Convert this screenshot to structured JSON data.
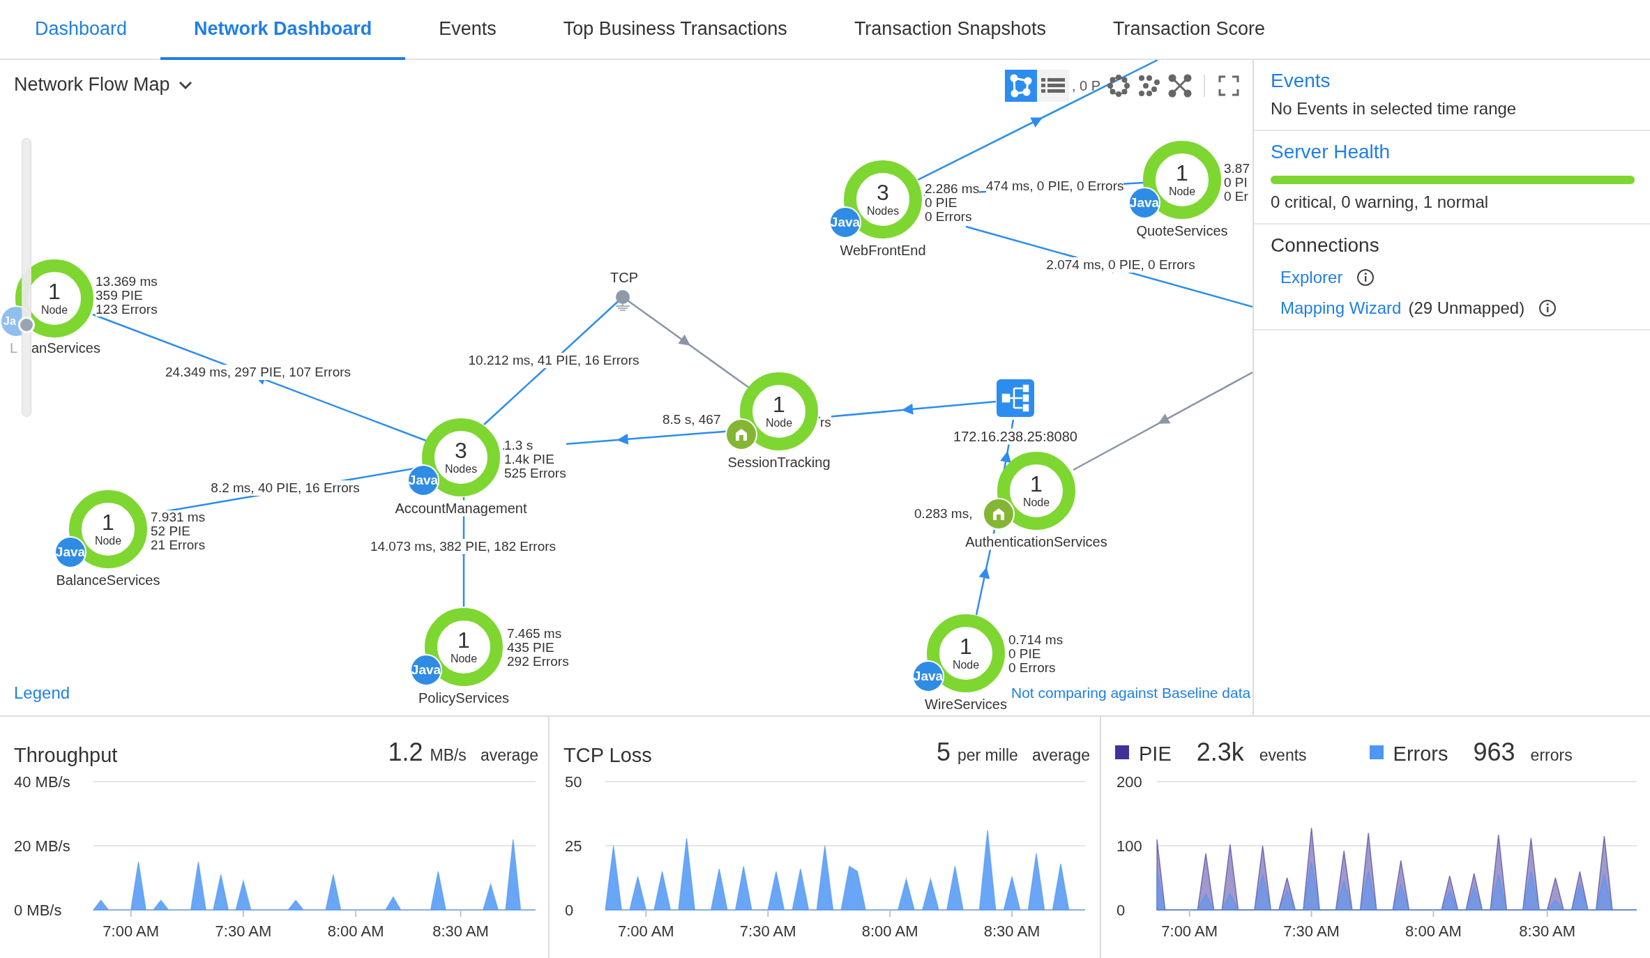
{
  "tabs": [
    {
      "label": "Dashboard",
      "selected": false,
      "kind": "link"
    },
    {
      "label": "Network Dashboard",
      "selected": true,
      "kind": "tab"
    },
    {
      "label": "Events",
      "selected": false,
      "kind": "tab"
    },
    {
      "label": "Top Business Transactions",
      "selected": false,
      "kind": "tab"
    },
    {
      "label": "Transaction Snapshots",
      "selected": false,
      "kind": "tab"
    },
    {
      "label": "Transaction Score",
      "selected": false,
      "kind": "tab"
    }
  ],
  "map": {
    "title": "Network Flow Map",
    "toolbar": [
      {
        "kind": "flow",
        "selected": true
      },
      {
        "kind": "list",
        "selected": false
      },
      {
        "kind": "circle",
        "selected": false
      },
      {
        "kind": "cluster",
        "selected": false
      },
      {
        "kind": "cross",
        "selected": false
      },
      {
        "kind": "fullscreen",
        "selected": false
      }
    ],
    "toolbar_backdrop_text": ", 0 P",
    "zoom_slider": {
      "level": 0.33
    },
    "nodes": [
      {
        "name": "anServices",
        "cut_letter": "L",
        "count": "1",
        "unit": "Node",
        "badge": {
          "kind": "java",
          "label": "Ja"
        },
        "stats": [
          "13.369 ms",
          "359 PIE",
          "123 Errors"
        ]
      },
      {
        "name": "AccountManagement",
        "count": "3",
        "unit": "Nodes",
        "badge": {
          "kind": "java",
          "label": "Java"
        },
        "stats": [
          "1.3 s",
          "1.4k PIE",
          "525 Errors"
        ]
      },
      {
        "name": "BalanceServices",
        "count": "1",
        "unit": "Node",
        "badge": {
          "kind": "java",
          "label": "Java"
        },
        "stats": [
          "7.931 ms",
          "52 PIE",
          "21 Errors"
        ]
      },
      {
        "name": "PolicyServices",
        "count": "1",
        "unit": "Node",
        "badge": {
          "kind": "java",
          "label": "Java"
        },
        "stats": [
          "7.465 ms",
          "435 PIE",
          "292 Errors"
        ]
      },
      {
        "name": "SessionTracking",
        "count": "1",
        "unit": "Node",
        "badge": {
          "kind": "home"
        }
      },
      {
        "name": "WebFrontEnd",
        "count": "3",
        "unit": "Nodes",
        "badge": {
          "kind": "java",
          "label": "Java"
        },
        "stats": [
          "2.286 ms",
          "0 PIE",
          "0 Errors"
        ]
      },
      {
        "name": "QuoteServices",
        "count": "1",
        "unit": "Node",
        "badge": {
          "kind": "java",
          "label": "Java"
        },
        "stats": [
          "3.87",
          "0 PI",
          "0 Er"
        ]
      },
      {
        "name": "AuthenticationServices",
        "count": "1",
        "unit": "Node",
        "badge": {
          "kind": "home"
        }
      },
      {
        "name": "WireServices",
        "count": "1",
        "unit": "Node",
        "badge": {
          "kind": "java",
          "label": "Java"
        },
        "stats": [
          "0.714 ms",
          "0 PIE",
          "0 Errors"
        ]
      }
    ],
    "endpoints": [
      {
        "kind": "tcp",
        "label": "TCP"
      },
      {
        "kind": "loadbalancer",
        "label": "172.16.238.25:8080"
      }
    ],
    "edge_labels": [
      "24.349 ms, 297 PIE, 107 Errors",
      "10.212 ms, 41 PIE, 16 Errors",
      "8.2 ms, 40 PIE, 16 Errors",
      "14.073 ms, 382 PIE, 182 Errors",
      "8.5 s, 467",
      "rs",
      "474 ms, 0 PIE, 0 Errors",
      "2.074 ms, 0 PIE, 0 Errors",
      "0.283 ms,"
    ],
    "legend_link": "Legend",
    "baseline_note": "Not comparing against Baseline data"
  },
  "side": {
    "events": {
      "title": "Events",
      "message": "No Events in selected time range"
    },
    "health": {
      "title": "Server Health",
      "level": 1,
      "summary": "0 critical, 0 warning, 1 normal"
    },
    "connections": {
      "title": "Connections",
      "links": [
        {
          "label": "Explorer"
        },
        {
          "label": "Mapping Wizard",
          "note": "(29 Unmapped)"
        }
      ]
    }
  },
  "panels": [
    {
      "kind": "metric",
      "value": "1.2",
      "unit": "MB/s",
      "suffix": "average",
      "chart_data": {
        "type": "area",
        "ylim": [
          0,
          40
        ],
        "yticks": [
          {
            "value": 0,
            "label": "0 MB/s"
          },
          {
            "value": 20,
            "label": "20 MB/s"
          },
          {
            "value": 40,
            "label": "40 MB/s"
          }
        ],
        "categories": [
          null,
          null,
          null,
          null,
          null,
          "7:00 AM",
          null,
          null,
          null,
          null,
          null,
          null,
          null,
          null,
          null,
          null,
          null,
          null,
          null,
          null,
          "7:30 AM",
          null,
          null,
          null,
          null,
          null,
          null,
          null,
          null,
          null,
          null,
          null,
          null,
          null,
          null,
          "8:00 AM",
          null,
          null,
          null,
          null,
          null,
          null,
          null,
          null,
          null,
          null,
          null,
          null,
          null,
          "8:30 AM",
          null,
          null,
          null,
          null,
          null,
          null,
          null,
          null,
          null,
          null
        ],
        "series": [
          {
            "name": "Throughput",
            "color": "#4f96f5",
            "values": [
              0,
              3,
              0,
              0,
              0,
              0,
              15,
              0,
              0,
              3,
              0,
              0,
              0,
              0,
              15,
              0,
              0,
              11,
              0,
              0,
              9,
              0,
              0,
              0,
              0,
              0,
              0,
              3,
              0,
              0,
              0,
              0,
              11,
              0,
              0,
              0,
              0,
              0,
              0,
              0,
              4,
              0,
              0,
              0,
              0,
              0,
              12,
              0,
              0,
              0,
              0,
              0,
              0,
              8,
              0,
              0,
              22,
              0,
              0,
              0
            ]
          }
        ]
      }
    },
    {
      "kind": "metric",
      "value": "5",
      "unit": "per mille",
      "suffix": "average",
      "chart_data": {
        "type": "area",
        "ylim": [
          0,
          50
        ],
        "yticks": [
          0,
          25,
          50
        ],
        "categories": [
          null,
          null,
          null,
          null,
          null,
          "7:00 AM",
          null,
          null,
          null,
          null,
          null,
          null,
          null,
          null,
          null,
          null,
          null,
          null,
          null,
          null,
          "7:30 AM",
          null,
          null,
          null,
          null,
          null,
          null,
          null,
          null,
          null,
          null,
          null,
          null,
          null,
          null,
          "8:00 AM",
          null,
          null,
          null,
          null,
          null,
          null,
          null,
          null,
          null,
          null,
          null,
          null,
          null,
          null,
          "8:30 AM",
          null,
          null,
          null,
          null,
          null,
          null,
          null,
          null,
          null
        ],
        "series": [
          {
            "name": "TCP Loss",
            "color": "#4f96f5",
            "values": [
              0,
              25,
              0,
              0,
              13,
              0,
              0,
              15,
              0,
              0,
              28,
              0,
              0,
              0,
              16,
              0,
              0,
              17,
              0,
              0,
              0,
              15,
              0,
              0,
              16,
              0,
              0,
              25,
              0,
              0,
              17,
              15,
              0,
              0,
              0,
              0,
              0,
              12,
              0,
              0,
              12,
              0,
              0,
              17,
              0,
              0,
              0,
              31,
              0,
              0,
              13,
              0,
              0,
              22,
              0,
              0,
              18,
              0,
              0,
              0
            ]
          }
        ]
      }
    },
    {
      "kind": "legend",
      "legend": [
        {
          "value": "2.3k",
          "unit": "events"
        },
        {
          "value": "963",
          "unit": "errors"
        }
      ],
      "chart_data": {
        "type": "area",
        "ylim": [
          0,
          200
        ],
        "yticks": [
          0,
          100,
          200
        ],
        "categories": [
          null,
          null,
          null,
          null,
          "7:00 AM",
          null,
          null,
          null,
          null,
          null,
          null,
          null,
          null,
          null,
          null,
          null,
          null,
          null,
          null,
          "7:30 AM",
          null,
          null,
          null,
          null,
          null,
          null,
          null,
          null,
          null,
          null,
          null,
          null,
          null,
          null,
          "8:00 AM",
          null,
          null,
          null,
          null,
          null,
          null,
          null,
          null,
          null,
          null,
          null,
          null,
          null,
          "8:30 AM",
          null,
          null,
          null,
          null,
          null,
          null,
          null,
          null,
          null,
          null,
          null
        ],
        "series": [
          {
            "name": "PIE",
            "color": "#3f3399",
            "values": [
              110,
              0,
              0,
              0,
              0,
              0,
              88,
              0,
              0,
              102,
              0,
              0,
              0,
              100,
              0,
              0,
              50,
              0,
              0,
              128,
              0,
              0,
              0,
              92,
              0,
              0,
              120,
              0,
              0,
              0,
              77,
              0,
              0,
              0,
              0,
              0,
              53,
              0,
              0,
              57,
              0,
              0,
              117,
              0,
              0,
              0,
              112,
              0,
              0,
              50,
              0,
              0,
              60,
              0,
              0,
              115,
              0,
              0,
              0,
              0
            ]
          },
          {
            "name": "Errors",
            "color": "#4f96f5",
            "values": [
              60,
              0,
              0,
              0,
              0,
              0,
              25,
              0,
              0,
              25,
              0,
              0,
              0,
              55,
              0,
              0,
              30,
              0,
              0,
              75,
              0,
              0,
              0,
              45,
              0,
              0,
              60,
              0,
              0,
              0,
              40,
              0,
              0,
              0,
              0,
              0,
              30,
              0,
              0,
              35,
              0,
              0,
              55,
              0,
              0,
              0,
              60,
              0,
              0,
              15,
              0,
              0,
              40,
              0,
              0,
              55,
              0,
              0,
              0,
              0
            ]
          }
        ]
      }
    }
  ]
}
